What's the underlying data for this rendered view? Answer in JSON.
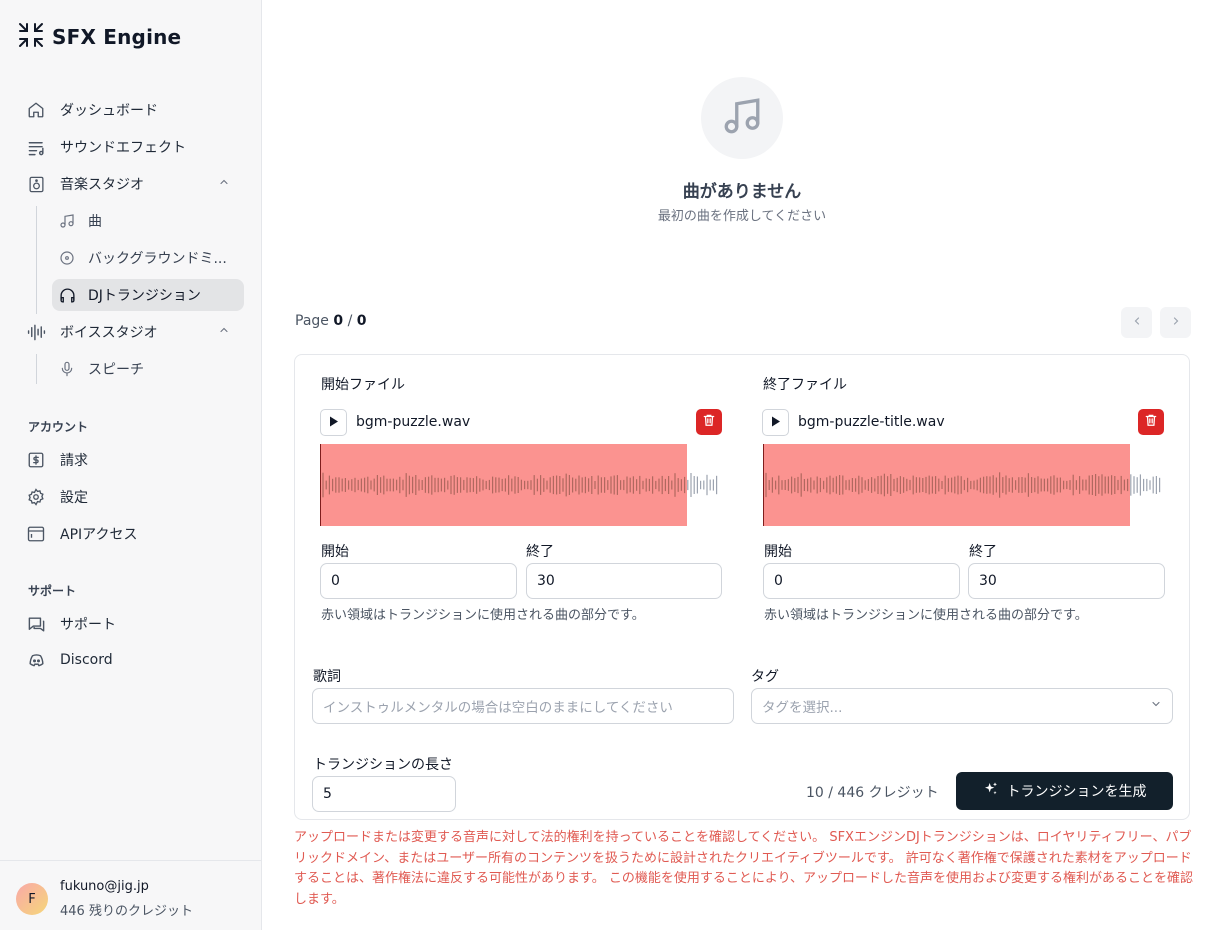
{
  "brand": {
    "name": "SFX Engine"
  },
  "sidebar": {
    "items": [
      {
        "label": "ダッシュボード",
        "icon": "home-icon"
      },
      {
        "label": "サウンドエフェクト",
        "icon": "playlist-icon"
      },
      {
        "label": "音楽スタジオ",
        "icon": "speaker-icon"
      },
      {
        "label": "ボイススタジオ",
        "icon": "audio-lines-icon"
      }
    ],
    "music_sub": [
      {
        "label": "曲",
        "icon": "music-notes-icon"
      },
      {
        "label": "バックグラウンドミ...",
        "icon": "disc-icon"
      },
      {
        "label": "DJトランジション",
        "icon": "headphones-icon",
        "active": true
      }
    ],
    "voice_sub": [
      {
        "label": "スピーチ",
        "icon": "microphone-icon"
      }
    ],
    "account_label": "アカウント",
    "account_items": [
      {
        "label": "請求",
        "icon": "dollar-icon"
      },
      {
        "label": "設定",
        "icon": "gear-icon"
      },
      {
        "label": "APIアクセス",
        "icon": "browser-icon"
      }
    ],
    "support_label": "サポート",
    "support_items": [
      {
        "label": "サポート",
        "icon": "chat-icon"
      },
      {
        "label": "Discord",
        "icon": "discord-icon"
      }
    ]
  },
  "user": {
    "initial": "F",
    "email": "fukuno@jig.jp",
    "credits_text": "446 残りのクレジット"
  },
  "empty_state": {
    "title": "曲がありません",
    "subtitle": "最初の曲を作成してください"
  },
  "pager": {
    "prefix": "Page",
    "current": "0",
    "separator": "/",
    "total": "0"
  },
  "transition": {
    "start_file": {
      "label": "開始ファイル",
      "name": "bgm-puzzle.wav",
      "start_label": "開始",
      "start_value": "0",
      "end_label": "終了",
      "end_value": "30",
      "selected_fraction": 0.92,
      "hint": "赤い領域はトランジションに使用される曲の部分です。"
    },
    "end_file": {
      "label": "終了ファイル",
      "name": "bgm-puzzle-title.wav",
      "start_label": "開始",
      "start_value": "0",
      "end_label": "終了",
      "end_value": "30",
      "selected_fraction": 0.92,
      "hint": "赤い領域はトランジションに使用される曲の部分です。"
    },
    "lyrics_label": "歌詞",
    "lyrics_placeholder": "インストゥルメンタルの場合は空白のままにしてください",
    "tags_label": "タグ",
    "tags_placeholder": "タグを選択...",
    "length_label": "トランジションの長さ",
    "length_value": "5",
    "credits_text": "10 / 446 クレジット",
    "generate_label": "トランジションを生成"
  },
  "legal_text": "アップロードまたは変更する音声に対して法的権利を持っていることを確認してください。 SFXエンジンDJトランジションは、ロイヤリティフリー、パブリックドメイン、またはユーザー所有のコンテンツを扱うために設計されたクリエイティブツールです。 許可なく著作権で保護された素材をアップロードすることは、著作権法に違反する可能性があります。 この機能を使用することにより、アップロードした音声を使用および変更する権利があることを確認します。",
  "colors": {
    "accent_dark": "#12202b",
    "region": "#fb9390",
    "danger": "#dc2626",
    "legal": "#e05a52"
  }
}
